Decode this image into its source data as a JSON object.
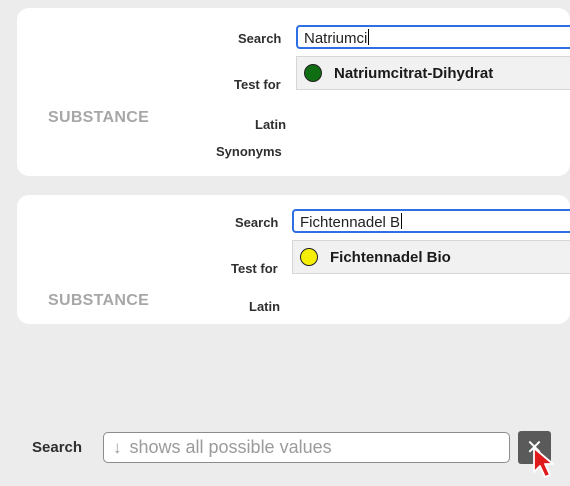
{
  "card1": {
    "substance_label": "SUBSTANCE",
    "search_label": "Search",
    "search_value": "Natriumci",
    "test_for_label": "Test for",
    "latin_label": "Latin",
    "synonyms_label": "Synonyms",
    "option": {
      "label": "Natriumcitrat-Dihydrat",
      "dot_color": "#0f6d12"
    }
  },
  "card2": {
    "substance_label": "SUBSTANCE",
    "search_label": "Search",
    "search_value": "Fichtennadel B",
    "test_for_label": "Test for",
    "latin_label": "Latin",
    "option": {
      "label": "Fichtennadel Bio",
      "dot_color": "#f5ee07"
    }
  },
  "bottom": {
    "search_label": "Search",
    "placeholder_arrow": "↓",
    "placeholder": "shows all possible values",
    "clear_glyph": "✕"
  }
}
